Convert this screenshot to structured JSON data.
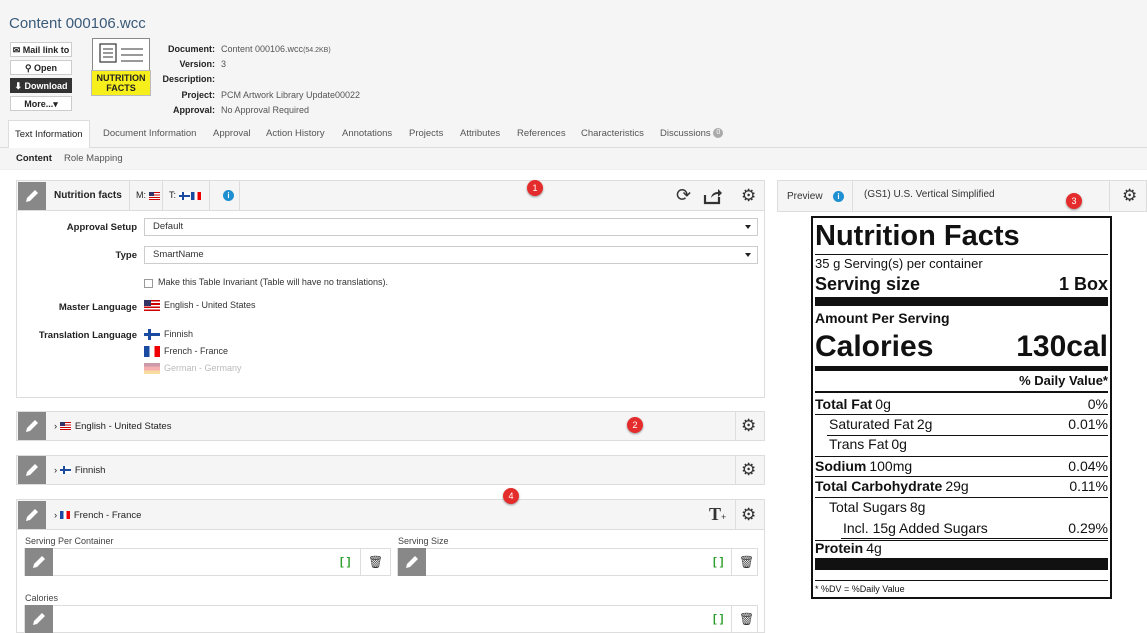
{
  "header": {
    "title": "Content 000106.wcc",
    "buttons": [
      "Mail link to",
      "Open",
      "Download",
      "More..."
    ],
    "thumb_label": "NUTRITION FACTS",
    "meta_keys": [
      "Document:",
      "Version:",
      "Description:",
      "Project:",
      "Approval:"
    ],
    "meta_vals": [
      "Content 000106.wcc",
      "3",
      "",
      "PCM Artwork Library Update00022",
      "No Approval Required"
    ],
    "doc_size": "(54.2KB)"
  },
  "tabs": [
    "Text Information",
    "Document Information",
    "Approval",
    "Action History",
    "Annotations",
    "Projects",
    "Attributes",
    "References",
    "Characteristics",
    "Discussions"
  ],
  "discussions_badge": "0",
  "subtabs": [
    "Content",
    "Role Mapping"
  ],
  "main_panel": {
    "title": "Nutrition facts",
    "m_label": "M:",
    "t_label": "T:",
    "approval_label": "Approval Setup",
    "approval_value": "Default",
    "type_label": "Type",
    "type_value": "SmartName",
    "invariant_text": "Make this Table Invariant (Table will have no translations).",
    "master_label": "Master Language",
    "master_value": "English - United States",
    "translation_label": "Translation Language",
    "translations": [
      "Finnish",
      "French - France",
      "German - Germany"
    ]
  },
  "lang_panels": [
    "English - United States",
    "Finnish",
    "French - France"
  ],
  "fields": [
    "Serving Per Container",
    "Serving Size",
    "Calories"
  ],
  "field_bracket": "[ ]",
  "callouts": [
    "1",
    "2",
    "3",
    "4"
  ],
  "preview": {
    "label": "Preview",
    "template": "(GS1) U.S. Vertical Simplified"
  },
  "nutrition": {
    "title": "Nutrition Facts",
    "servings": "35 g Serving(s) per container",
    "serving_size_label": "Serving size",
    "serving_size_value": "1 Box",
    "amount_per": "Amount Per Serving",
    "calories_label": "Calories",
    "calories_value": "130cal",
    "daily_value": "% Daily Value*",
    "rows": [
      {
        "label": "Total Fat",
        "amount": "0g",
        "pct": "0%"
      },
      {
        "label": "Saturated Fat",
        "amount": "2g",
        "pct": "0.01%"
      },
      {
        "label": "Trans Fat",
        "amount": "0g",
        "pct": ""
      },
      {
        "label": "Sodium",
        "amount": "100mg",
        "pct": "0.04%"
      },
      {
        "label": "Total Carbohydrate",
        "amount": "29g",
        "pct": "0.11%"
      },
      {
        "label": "Total Sugars",
        "amount": "8g",
        "pct": ""
      },
      {
        "label": "Incl. 15g Added Sugars",
        "amount": "",
        "pct": "0.29%"
      },
      {
        "label": "Protein",
        "amount": "4g",
        "pct": ""
      }
    ],
    "footnote": "* %DV = %Daily Value"
  }
}
